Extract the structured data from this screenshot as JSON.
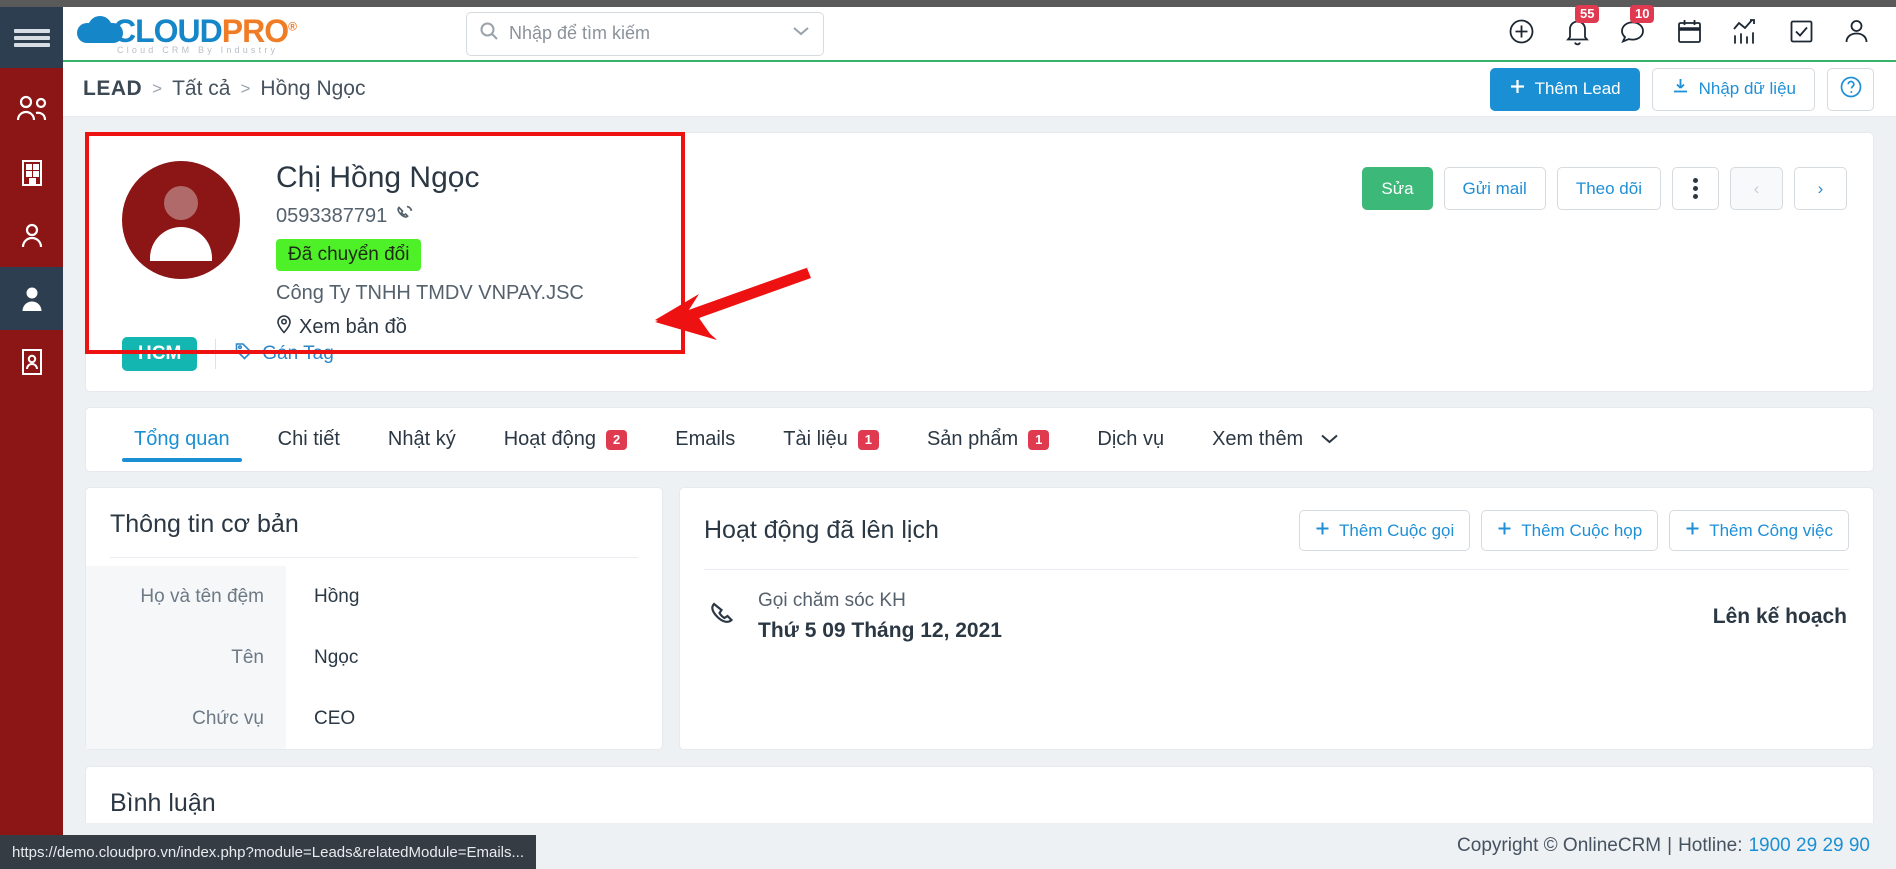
{
  "brand": {
    "logo_cloud": "CLOUD",
    "logo_pro": "PRO",
    "logo_reg": "®",
    "logo_tagline": "Cloud CRM By Industry",
    "accent_blue": "#1b8fd3",
    "accent_orange": "#f07c25",
    "accent_green": "#3cb878",
    "rail_red": "#8c1616",
    "badge_red": "#e03a50",
    "tag_teal": "#13b6b0",
    "status_green": "#4ef028",
    "annotation_red": "#ee1111"
  },
  "search": {
    "placeholder": "Nhập để tìm kiếm",
    "value": ""
  },
  "header_icons": [
    {
      "name": "add-circle-icon",
      "badge": ""
    },
    {
      "name": "bell-icon",
      "badge": "55"
    },
    {
      "name": "chat-icon",
      "badge": "10"
    },
    {
      "name": "calendar-icon",
      "badge": ""
    },
    {
      "name": "analytics-icon",
      "badge": ""
    },
    {
      "name": "task-check-icon",
      "badge": ""
    },
    {
      "name": "user-account-icon",
      "badge": ""
    }
  ],
  "breadcrumb": {
    "module": "LEAD",
    "sep": ">",
    "list": "Tất cả",
    "current": "Hồng Ngọc"
  },
  "crumb_actions": {
    "add_lead": "Thêm Lead",
    "import": "Nhập dữ liệu",
    "help": "?"
  },
  "lead": {
    "name": "Chị Hồng Ngọc",
    "phone": "0593387791",
    "status": "Đã chuyển đổi",
    "company": "Công Ty TNHH TMDV VNPAY.JSC",
    "map_link": "Xem bản đồ",
    "tag": "HCM",
    "assign_tag": "Gán Tag"
  },
  "lead_actions": {
    "edit": "Sửa",
    "send_mail": "Gửi mail",
    "follow": "Theo dõi",
    "more": "⋮",
    "prev": "‹",
    "next": "›"
  },
  "tabs": [
    {
      "label": "Tổng quan",
      "badge": "",
      "active": true
    },
    {
      "label": "Chi tiết",
      "badge": "",
      "active": false
    },
    {
      "label": "Nhật ký",
      "badge": "",
      "active": false
    },
    {
      "label": "Hoạt động",
      "badge": "2",
      "active": false
    },
    {
      "label": "Emails",
      "badge": "",
      "active": false
    },
    {
      "label": "Tài liệu",
      "badge": "1",
      "active": false
    },
    {
      "label": "Sản phẩm",
      "badge": "1",
      "active": false
    },
    {
      "label": "Dịch vụ",
      "badge": "",
      "active": false
    }
  ],
  "tabs_more": "Xem thêm",
  "basic_info": {
    "title": "Thông tin cơ bản",
    "fields": [
      {
        "label": "Họ và tên đệm",
        "value": "Hồng"
      },
      {
        "label": "Tên",
        "value": "Ngọc"
      },
      {
        "label": "Chức vụ",
        "value": "CEO"
      }
    ]
  },
  "scheduled": {
    "title": "Hoạt động đã lên lịch",
    "add_call": "Thêm Cuộc gọi",
    "add_meeting": "Thêm Cuộc họp",
    "add_task": "Thêm Công việc",
    "items": [
      {
        "icon": "phone-icon",
        "title": "Gọi chăm sóc KH",
        "date": "Thứ 5 09 Tháng 12, 2021",
        "status": "Lên kế hoạch"
      }
    ]
  },
  "comments": {
    "title": "Bình luận"
  },
  "footer": {
    "copyright": "Copyright © OnlineCRM",
    "divider": "|",
    "hotline_label": "Hotline:",
    "hotline_number": "1900 29 29 90"
  },
  "status_bar": {
    "url": "https://demo.cloudpro.vn/index.php?module=Leads&relatedModule=Emails..."
  }
}
